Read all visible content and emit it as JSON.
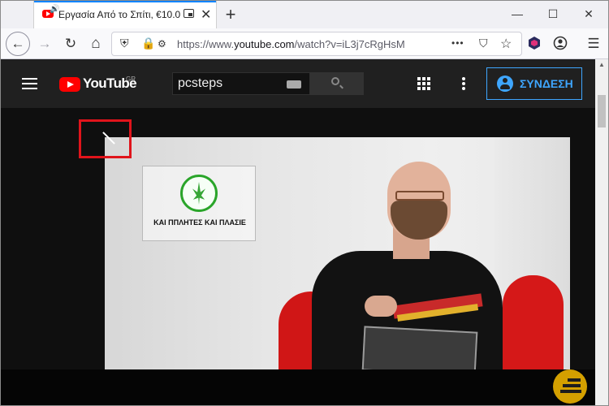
{
  "browser": {
    "tab": {
      "title": "Εργασία Από το Σπίτι, €10.0",
      "close_glyph": "✕",
      "speaker_glyph": "🔊"
    },
    "new_tab_glyph": "+",
    "window_controls": {
      "minimize": "—",
      "maximize": "☐",
      "close": "✕"
    },
    "nav": {
      "back": "←",
      "forward": "→",
      "reload": "↻",
      "home": "⌂"
    },
    "url": {
      "prefix": "https://www.",
      "host": "youtube.com",
      "path": "/watch?v=iL3j7cRgHsM"
    },
    "toolbar_glyphs": {
      "more": "•••",
      "pocket": "⛉",
      "bookmark": "☆",
      "menu": "☰"
    }
  },
  "youtube": {
    "logo_text": "YouTube",
    "region": "GR",
    "search": {
      "value": "pcsteps"
    },
    "signin_label": "ΣΥΝΔΕΣΗ"
  },
  "video": {
    "sign_text": "ΚΑΙ ΠΠΛΗΤΕΣ ΚΑΙ ΠΛΑΣΙΕ"
  },
  "colors": {
    "accent": "#0a84ff",
    "youtube_red": "#ff0000",
    "signin_blue": "#3ea6ff",
    "highlight_red": "#e0141b"
  }
}
